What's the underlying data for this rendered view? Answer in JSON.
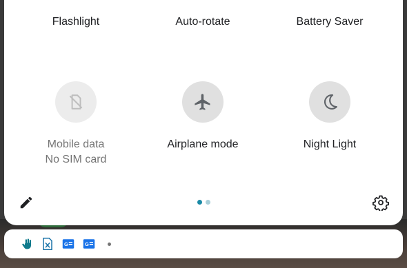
{
  "quick_settings": {
    "row1": [
      {
        "label": "Flashlight"
      },
      {
        "label": "Auto-rotate"
      },
      {
        "label": "Battery Saver"
      }
    ],
    "row2": [
      {
        "label": "Mobile data",
        "sublabel": "No SIM card",
        "icon": "no-sim-icon",
        "state": "disabled"
      },
      {
        "label": "Airplane mode",
        "icon": "airplane-icon",
        "state": "off"
      },
      {
        "label": "Night Light",
        "icon": "moon-icon",
        "state": "off"
      }
    ],
    "page_indicator": {
      "current": 1,
      "total": 2
    },
    "edit_icon": "pencil-icon",
    "settings_icon": "gear-icon"
  },
  "notification_strip": {
    "icons": [
      "hand-gesture-icon",
      "sheets-file-icon",
      "google-news-icon",
      "google-news-icon"
    ],
    "more_indicator": "dot-icon"
  },
  "colors": {
    "accent": "#1a8aa6",
    "tile_bg": "#e0e0e0",
    "icon": "#5f6368"
  }
}
